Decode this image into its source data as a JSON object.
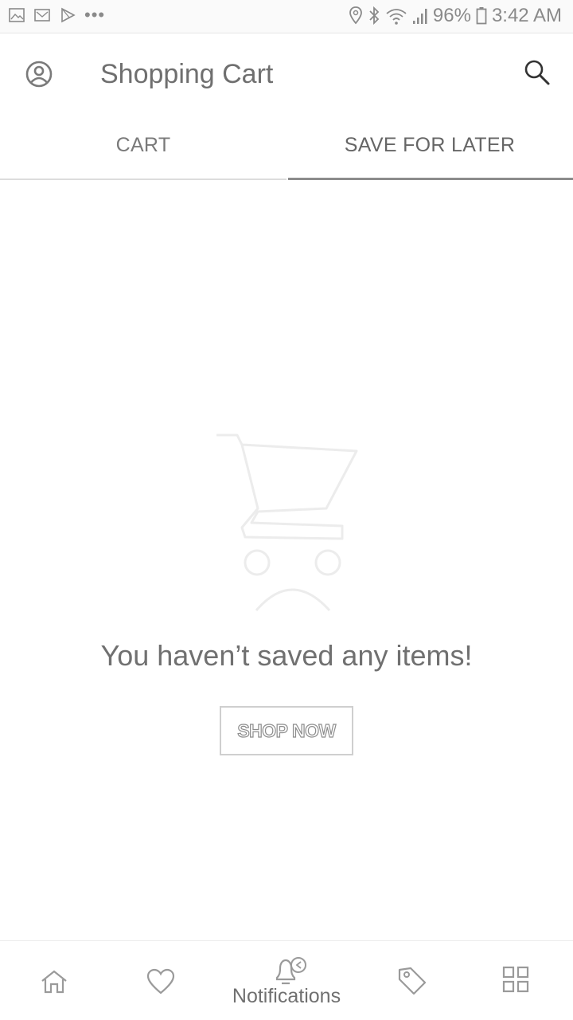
{
  "status_bar": {
    "battery": "96%",
    "time": "3:42 AM",
    "icons": [
      "gallery-icon",
      "mail-icon",
      "play-store-icon",
      "more-dots-icon",
      "location-icon",
      "bluetooth-icon",
      "wifi-icon",
      "signal-icon",
      "battery-icon"
    ]
  },
  "app_bar": {
    "title": "Shopping Cart",
    "left_icon": "account-icon",
    "right_icon": "search-icon"
  },
  "tabs": [
    {
      "label": "CART",
      "active": false
    },
    {
      "label": "SAVE FOR LATER",
      "active": true
    }
  ],
  "empty_state": {
    "icon": "sad-cart-icon",
    "message": "You haven’t saved any items!",
    "button_label": "SHOP NOW"
  },
  "bottom_nav": {
    "items": [
      {
        "icon": "home-icon"
      },
      {
        "icon": "heart-icon"
      },
      {
        "icon": "bell-icon",
        "label": "Notifications"
      },
      {
        "icon": "tag-icon"
      },
      {
        "icon": "grid-icon"
      }
    ]
  },
  "colors": {
    "background": "#ffffff",
    "text": "#6f6f6f",
    "active_tab_indicator": "#8c8c8c",
    "divider": "#dcdcdc"
  }
}
